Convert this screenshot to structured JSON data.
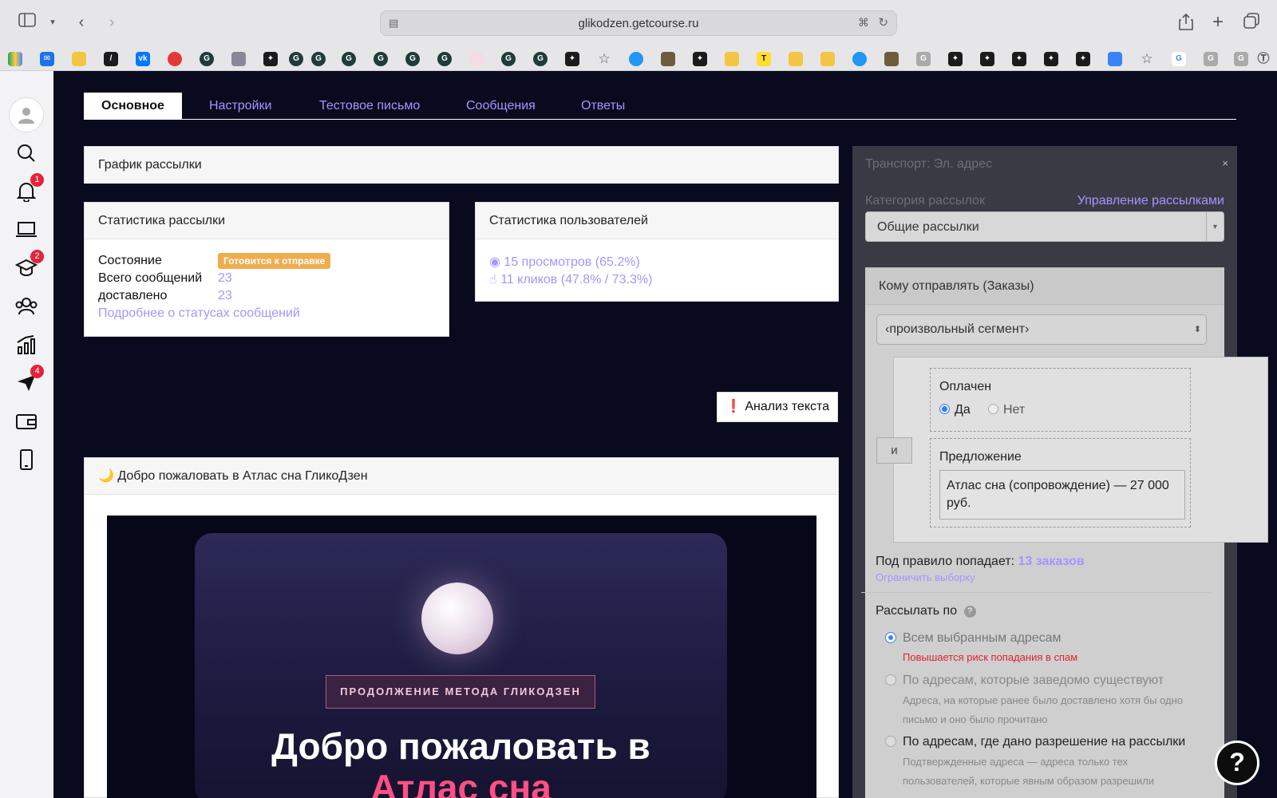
{
  "browser": {
    "url": "glikodzen.getcourse.ru"
  },
  "sidebar": {
    "badges": {
      "notifications": "1",
      "training": "2",
      "messages": "4"
    }
  },
  "tabs": [
    {
      "label": "Основное",
      "active": true
    },
    {
      "label": "Настройки"
    },
    {
      "label": "Тестовое письмо"
    },
    {
      "label": "Сообщения"
    },
    {
      "label": "Ответы"
    }
  ],
  "schedule": {
    "title": "График рассылки"
  },
  "mail_stats": {
    "title": "Статистика рассылки",
    "state_label": "Состояние",
    "state_badge": "Готовится к отправке",
    "total_label": "Всего сообщений",
    "total_value": "23",
    "delivered_label": "доставлено",
    "delivered_value": "23",
    "details_link": "Подробнее о статусах сообщений"
  },
  "user_stats": {
    "title": "Статистика пользователей",
    "views": "15 просмотров (65.2%)",
    "clicks": "11 кликов (47.8% / 73.3%)"
  },
  "analysis_button": "Анализ текста",
  "email_preview": {
    "subject": "🌙 Добро пожаловать в Атлас сна ГликоДзен",
    "pill": "ПРОДОЛЖЕНИЕ МЕТОДА ГЛИКОДЗЕН",
    "hero_line1": "Добро пожаловать в",
    "hero_line2": "Атлас сна"
  },
  "right_panel": {
    "transport": "Транспорт: Эл. адрес",
    "close": "×",
    "category_label": "Категория рассылок",
    "manage_link": "Управление рассылками",
    "category_value": "Общие рассылки",
    "recipients_title": "Кому отправлять (Заказы)",
    "segment_value": "‹произвольный сегмент›",
    "and_button": "и",
    "paid_label": "Оплачен",
    "paid_yes": "Да",
    "paid_no": "Нет",
    "offer_label": "Предложение",
    "offer_value": "Атлас сна (сопровождение) — 27 000 руб.",
    "rule_prefix": "Под правило попадает:",
    "rule_count": "13 заказов",
    "limit_link": "Ограничить выборку",
    "send_by_label": "Рассылать по",
    "opt1": "Всем выбранным адресам",
    "opt1_warn": "Повышается риск попадания в спам",
    "opt2": "По адресам, которые заведомо существуют",
    "opt2_desc1": "Адреса, на которые ранее было доставлено хотя бы одно",
    "opt2_desc2": "письмо и оно было прочитано",
    "opt3": "По адресам, где дано разрешение на рассылки",
    "opt3_desc1": "Подтвержденные адреса — адреса только тех",
    "opt3_desc2": "пользователей, которые явным образом разрешили"
  },
  "help_button": "?"
}
